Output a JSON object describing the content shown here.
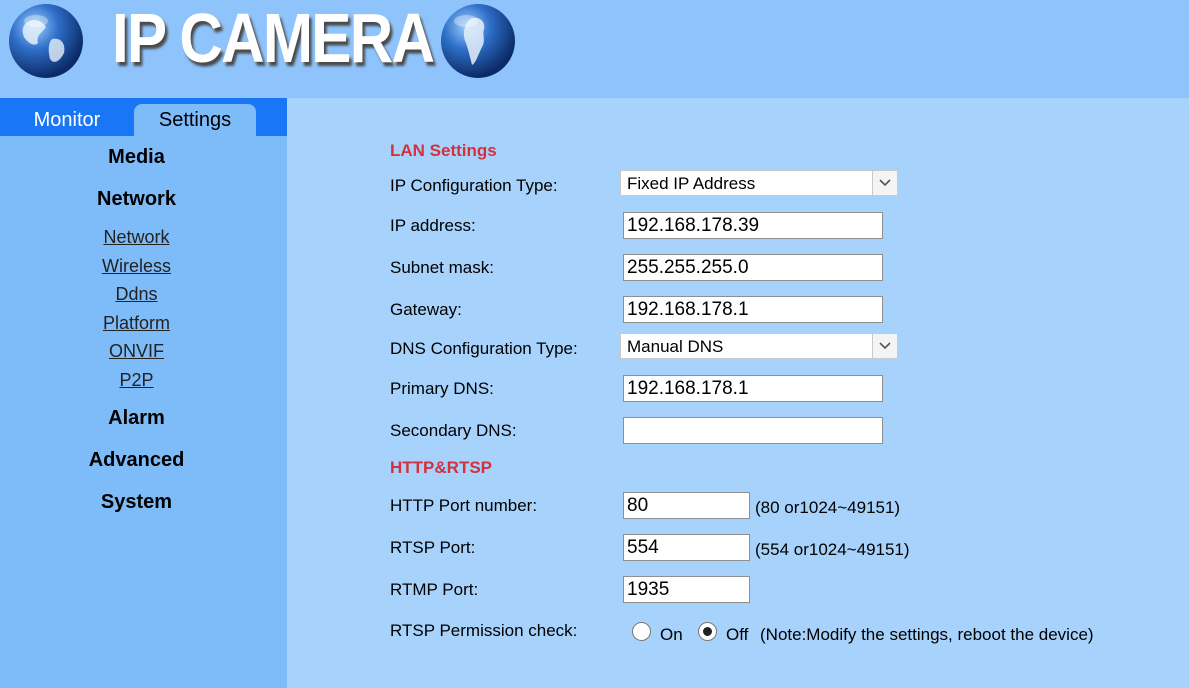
{
  "header": {
    "logo_text": "IP CAMERA",
    "left_icon": "globe-icon",
    "right_icon": "globe-icon"
  },
  "tabs": [
    {
      "label": "Monitor",
      "active": false
    },
    {
      "label": "Settings",
      "active": true
    }
  ],
  "sidebar": {
    "media": "Media",
    "network": "Network",
    "network_items": [
      "Network",
      "Wireless",
      "Ddns",
      "Platform",
      "ONVIF",
      "P2P"
    ],
    "alarm": "Alarm",
    "advanced": "Advanced",
    "system": "System"
  },
  "lan": {
    "title": "LAN Settings",
    "ip_config_type_label": "IP Configuration Type:",
    "ip_config_type_value": "Fixed IP Address",
    "ip_address_label": "IP address:",
    "ip_address_value": "192.168.178.39",
    "subnet_label": "Subnet mask:",
    "subnet_value": "255.255.255.0",
    "gateway_label": "Gateway:",
    "gateway_value": "192.168.178.1",
    "dns_config_type_label": "DNS Configuration Type:",
    "dns_config_type_value": "Manual DNS",
    "primary_dns_label": "Primary DNS:",
    "primary_dns_value": "192.168.178.1",
    "secondary_dns_label": "Secondary DNS:",
    "secondary_dns_value": ""
  },
  "http": {
    "title": "HTTP&RTSP",
    "http_port_label": "HTTP Port number:",
    "http_port_value": "80",
    "http_port_hint": "(80 or1024~49151)",
    "rtsp_port_label": "RTSP Port:",
    "rtsp_port_value": "554",
    "rtsp_port_hint": "(554 or1024~49151)",
    "rtmp_port_label": "RTMP Port:",
    "rtmp_port_value": "1935",
    "rtsp_perm_label": "RTSP Permission check:",
    "on_label": "On",
    "off_label": "Off",
    "selected": "Off",
    "note": "(Note:Modify the settings, reboot the device)"
  },
  "colors": {
    "header_bg": "#8ec4fb",
    "sidebar_bg": "#7ebcf9",
    "tabbar_bg": "#1976f6",
    "main_bg": "#a6d2fb",
    "section_title": "#d6303d"
  }
}
